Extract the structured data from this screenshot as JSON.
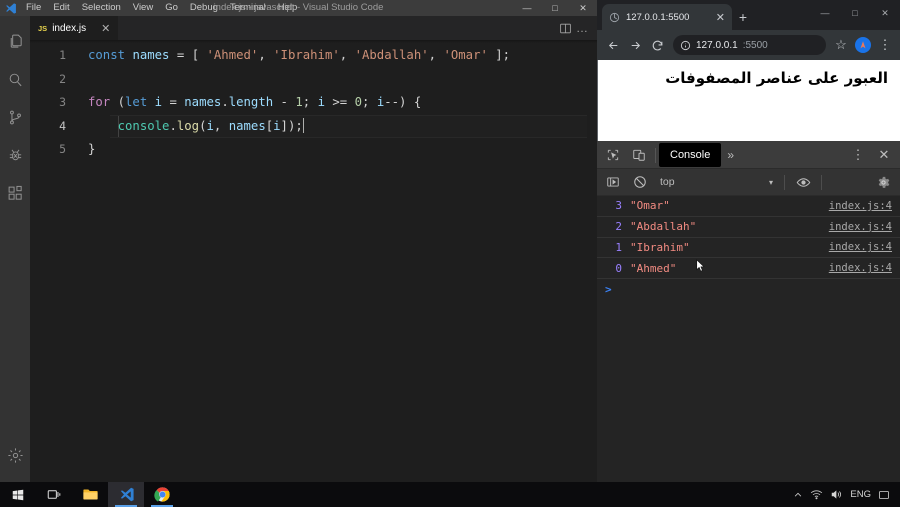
{
  "vscode": {
    "window_title": "index.js - javascript - Visual Studio Code",
    "menu": [
      "File",
      "Edit",
      "Selection",
      "View",
      "Go",
      "Debug",
      "Terminal",
      "Help"
    ],
    "window_controls": {
      "minimize": "—",
      "maximize": "□",
      "close": "✕"
    },
    "activity_bar": [
      {
        "name": "explorer-icon",
        "label": "Explorer"
      },
      {
        "name": "search-icon",
        "label": "Search"
      },
      {
        "name": "source-control-icon",
        "label": "Source Control"
      },
      {
        "name": "run-debug-icon",
        "label": "Run and Debug"
      },
      {
        "name": "extensions-icon",
        "label": "Extensions"
      },
      {
        "name": "settings-gear-icon",
        "label": "Manage"
      }
    ],
    "tab": {
      "label": "index.js",
      "badge": "JS",
      "close": "✕"
    },
    "editor_actions": {
      "split_editor": "split-editor-icon",
      "more": "…"
    },
    "code": {
      "lines": [
        {
          "num": "1",
          "tokens": [
            {
              "t": "const",
              "c": "tok-kw"
            },
            {
              "t": " ",
              "c": "tok-op"
            },
            {
              "t": "names",
              "c": "tok-var"
            },
            {
              "t": " = ",
              "c": "tok-op"
            },
            {
              "t": "[",
              "c": "tok-punc"
            },
            {
              "t": " ",
              "c": "tok-op"
            },
            {
              "t": "'Ahmed'",
              "c": "tok-str"
            },
            {
              "t": ", ",
              "c": "tok-punc"
            },
            {
              "t": "'Ibrahim'",
              "c": "tok-str"
            },
            {
              "t": ", ",
              "c": "tok-punc"
            },
            {
              "t": "'Abdallah'",
              "c": "tok-str"
            },
            {
              "t": ", ",
              "c": "tok-punc"
            },
            {
              "t": "'Omar'",
              "c": "tok-str"
            },
            {
              "t": " ]; ",
              "c": "tok-punc"
            }
          ]
        },
        {
          "num": "2",
          "tokens": []
        },
        {
          "num": "3",
          "tokens": [
            {
              "t": "for",
              "c": "tok-ctl"
            },
            {
              "t": " (",
              "c": "tok-punc"
            },
            {
              "t": "let",
              "c": "tok-kw"
            },
            {
              "t": " ",
              "c": "tok-op"
            },
            {
              "t": "i",
              "c": "tok-var"
            },
            {
              "t": " = ",
              "c": "tok-op"
            },
            {
              "t": "names",
              "c": "tok-var"
            },
            {
              "t": ".",
              "c": "tok-punc"
            },
            {
              "t": "length",
              "c": "tok-var"
            },
            {
              "t": " - ",
              "c": "tok-op"
            },
            {
              "t": "1",
              "c": "tok-num"
            },
            {
              "t": "; ",
              "c": "tok-punc"
            },
            {
              "t": "i",
              "c": "tok-var"
            },
            {
              "t": " >= ",
              "c": "tok-op"
            },
            {
              "t": "0",
              "c": "tok-num"
            },
            {
              "t": "; ",
              "c": "tok-punc"
            },
            {
              "t": "i",
              "c": "tok-var"
            },
            {
              "t": "--",
              "c": "tok-op"
            },
            {
              "t": ") ",
              "c": "tok-punc"
            },
            {
              "t": "{",
              "c": "tok-punc"
            }
          ]
        },
        {
          "num": "4",
          "current": true,
          "tokens": [
            {
              "t": "    ",
              "c": "tok-op"
            },
            {
              "t": "console",
              "c": "tok-obj"
            },
            {
              "t": ".",
              "c": "tok-punc"
            },
            {
              "t": "log",
              "c": "tok-fn"
            },
            {
              "t": "(",
              "c": "tok-punc"
            },
            {
              "t": "i",
              "c": "tok-var"
            },
            {
              "t": ", ",
              "c": "tok-punc"
            },
            {
              "t": "names",
              "c": "tok-var"
            },
            {
              "t": "[",
              "c": "tok-punc"
            },
            {
              "t": "i",
              "c": "tok-var"
            },
            {
              "t": "]",
              "c": "tok-punc"
            },
            {
              "t": ");",
              "c": "tok-punc"
            }
          ]
        },
        {
          "num": "5",
          "tokens": [
            {
              "t": "}",
              "c": "tok-punc"
            }
          ]
        }
      ]
    }
  },
  "chrome": {
    "tab": {
      "title": "127.0.0.1:5500",
      "close": "✕"
    },
    "new_tab": "+",
    "window_controls": {
      "minimize": "—",
      "maximize": "□",
      "close": "✕"
    },
    "nav": {
      "back": "←",
      "forward": "→",
      "reload": "⟳"
    },
    "omnibox": {
      "host": "127.0.0.1",
      "rest": ":5500",
      "full": "127.0.0.1:5500",
      "info_icon": "site-info-icon"
    },
    "star": "☆",
    "menu": "⋮",
    "page": {
      "heading": "العبور على عناصر المصفوفات"
    }
  },
  "devtools": {
    "toolbar": {
      "inspect": "inspect-element-icon",
      "device_toolbar": "device-toolbar-icon",
      "tabs": [
        {
          "label": "Console",
          "active": true
        }
      ],
      "more_tabs": "»",
      "settings_menu": "⋮",
      "close": "✕"
    },
    "filter_bar": {
      "clear_console": "clear-console-icon",
      "no_entry": "no-entry-icon",
      "context": "top",
      "context_caret": "▾",
      "eye": "live-expression-icon",
      "settings": "settings-gear-icon"
    },
    "console_logs": [
      {
        "index": "3",
        "value": "\"Omar\"",
        "source": "index.js:4"
      },
      {
        "index": "2",
        "value": "\"Abdallah\"",
        "source": "index.js:4"
      },
      {
        "index": "1",
        "value": "\"Ibrahim\"",
        "source": "index.js:4"
      },
      {
        "index": "0",
        "value": "\"Ahmed\"",
        "source": "index.js:4"
      }
    ],
    "prompt": ">"
  },
  "taskbar": {
    "items": [
      {
        "name": "start-button",
        "label": "Start"
      },
      {
        "name": "task-view-button",
        "label": "Task View"
      },
      {
        "name": "file-explorer-button",
        "label": "File Explorer"
      },
      {
        "name": "vscode-taskbar-button",
        "label": "Visual Studio Code"
      },
      {
        "name": "chrome-taskbar-button",
        "label": "Google Chrome"
      }
    ],
    "tray": {
      "show_hidden": "⌃",
      "network": "network-icon",
      "volume": "volume-icon",
      "language": "ENG",
      "notifications": "notification-icon"
    }
  },
  "colors": {
    "vscode_bg": "#1e1e1e",
    "vscode_titlebar": "#3c3c3c",
    "activity_bar": "#333333",
    "chrome_bg": "#202124",
    "chrome_toolbar": "#323639",
    "devtools_bg": "#242424",
    "accent_blue": "#1a73e8",
    "log_index": "#9980ff",
    "log_string": "#f28b82",
    "keyword": "#569cd6",
    "control": "#c586c0",
    "string": "#ce9178",
    "number": "#b5cea8",
    "function": "#dcdcaa",
    "object": "#4ec9b0"
  }
}
